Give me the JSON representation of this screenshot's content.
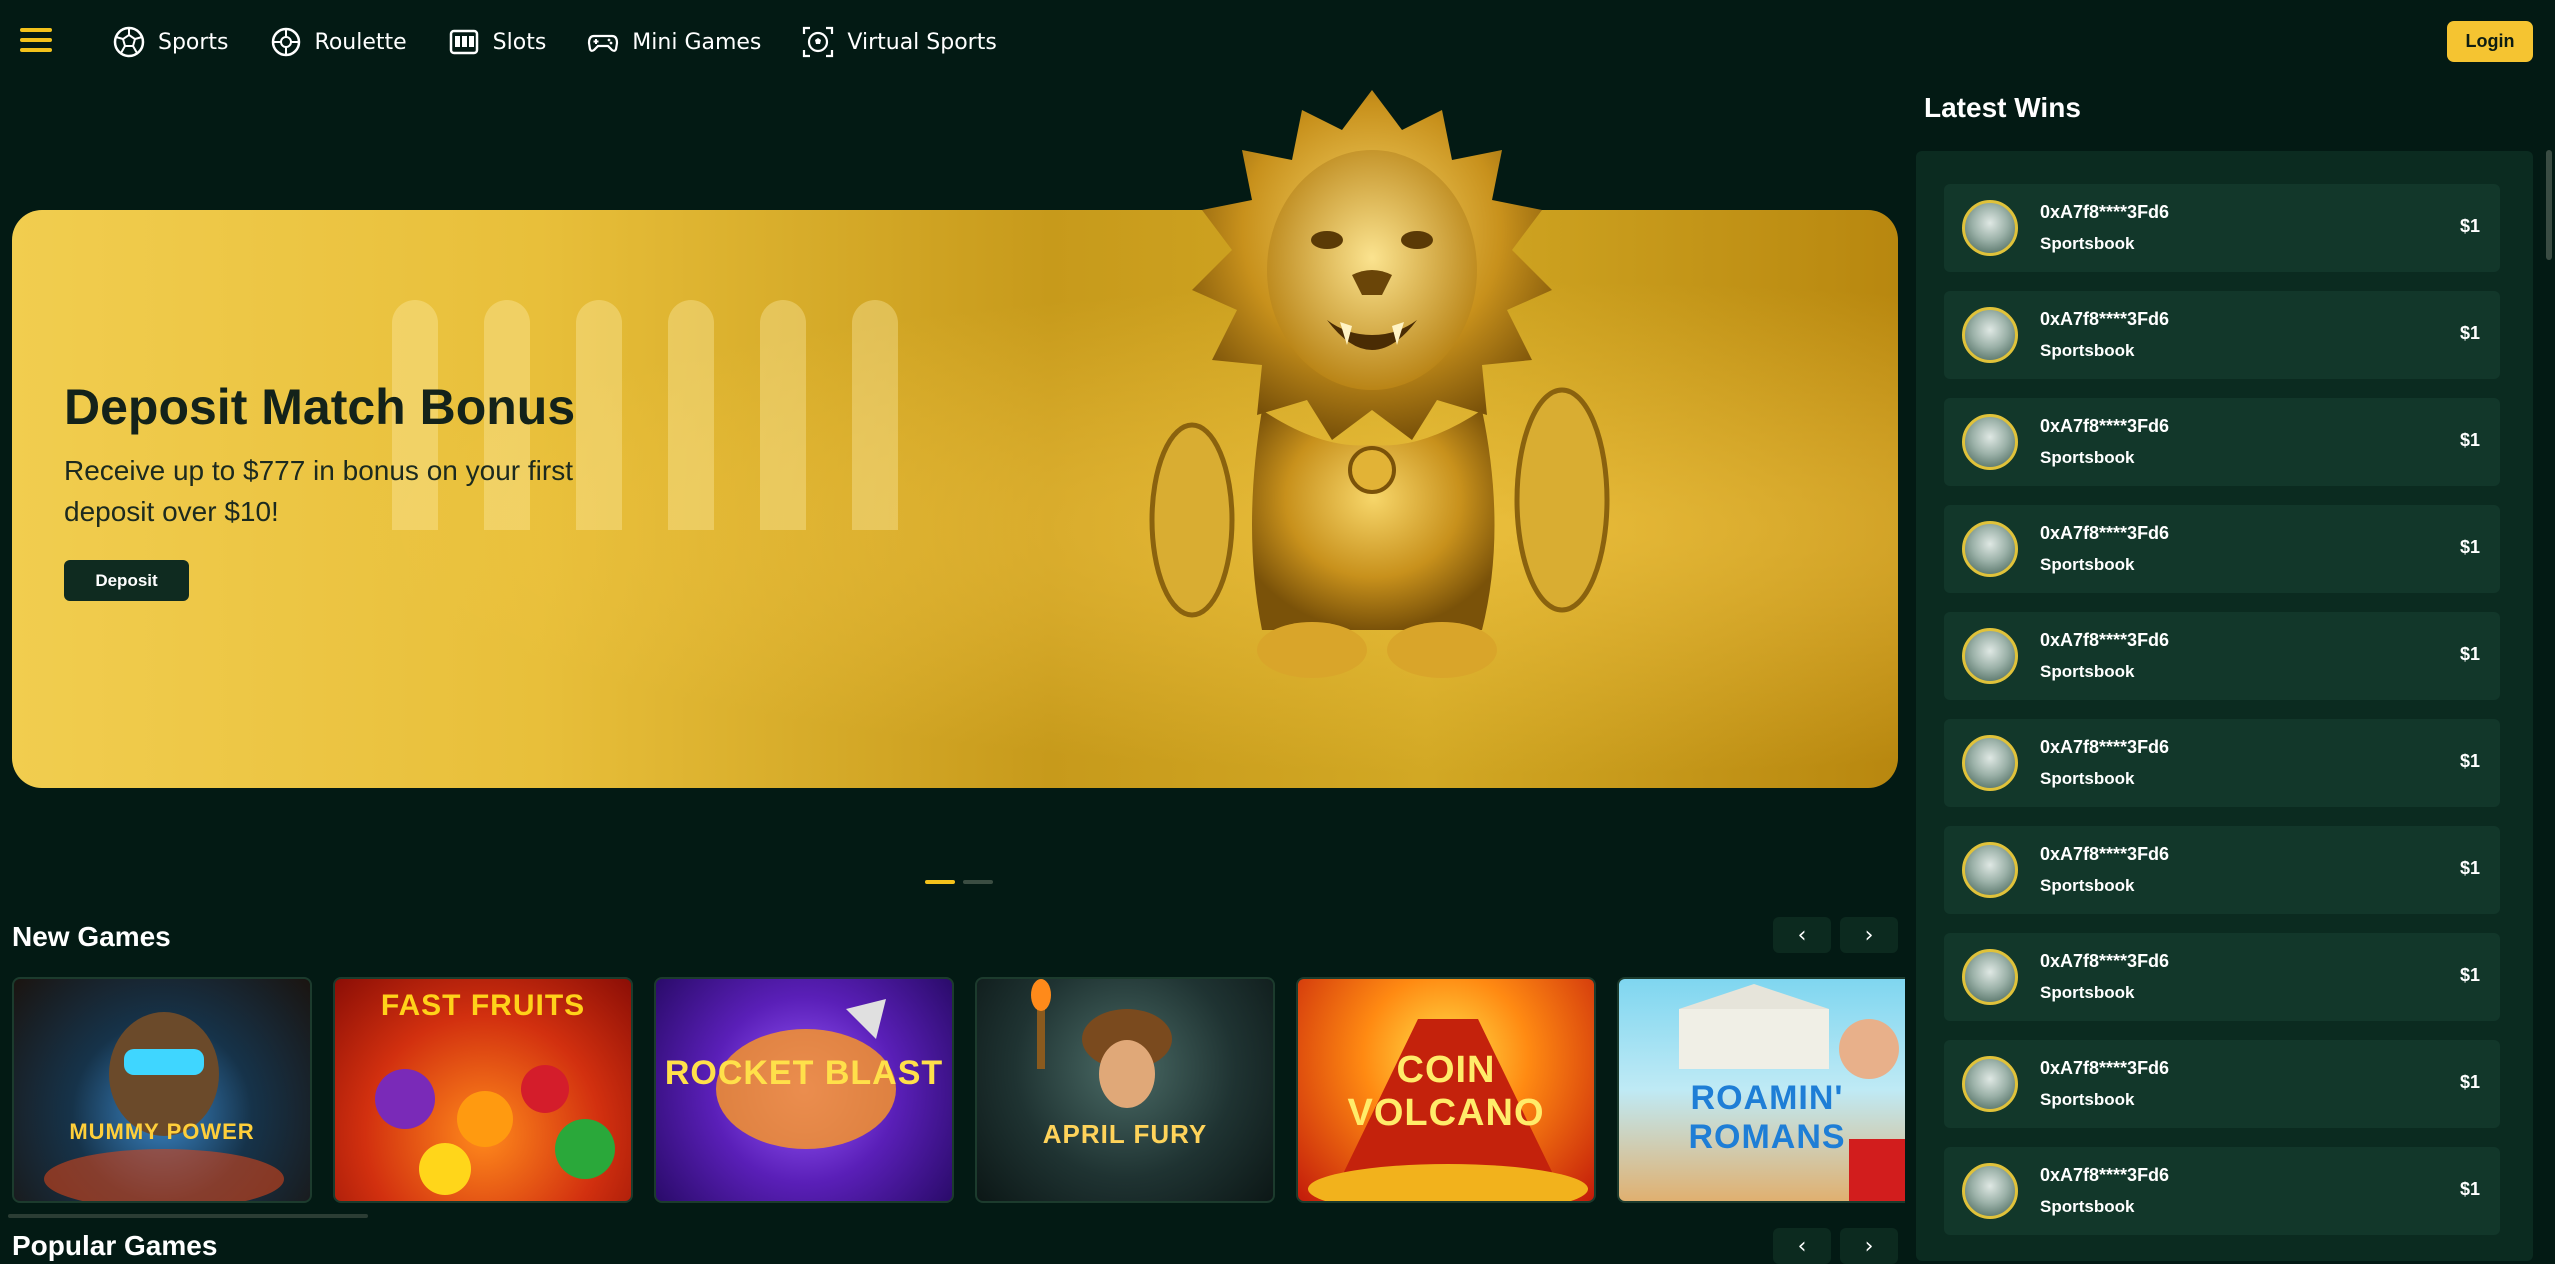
{
  "nav": {
    "items": [
      {
        "label": "Sports",
        "icon": "soccer-ball-icon"
      },
      {
        "label": "Roulette",
        "icon": "roulette-icon"
      },
      {
        "label": "Slots",
        "icon": "slot-machine-icon"
      },
      {
        "label": "Mini Games",
        "icon": "gamepad-icon"
      },
      {
        "label": "Virtual Sports",
        "icon": "virtual-ball-icon"
      }
    ],
    "login_label": "Login"
  },
  "hero": {
    "title": "Deposit Match Bonus",
    "subtitle": "Receive up to $777 in bonus on your first deposit over $10!",
    "button_label": "Deposit",
    "slide_count": 2,
    "active_slide": 1
  },
  "new_games": {
    "title": "New Games",
    "games": [
      {
        "name": "MUMMY POWER"
      },
      {
        "name": "FAST FRUITS"
      },
      {
        "name": "ROCKET BLAST"
      },
      {
        "name": "APRIL FURY"
      },
      {
        "name": "COIN VOLCANO"
      },
      {
        "name": "ROAMIN' ROMANS"
      }
    ]
  },
  "popular_games": {
    "title": "Popular Games"
  },
  "latest_wins": {
    "title": "Latest Wins",
    "rows": [
      {
        "address": "0xA7f8****3Fd6",
        "type": "Sportsbook",
        "amount": "$1"
      },
      {
        "address": "0xA7f8****3Fd6",
        "type": "Sportsbook",
        "amount": "$1"
      },
      {
        "address": "0xA7f8****3Fd6",
        "type": "Sportsbook",
        "amount": "$1"
      },
      {
        "address": "0xA7f8****3Fd6",
        "type": "Sportsbook",
        "amount": "$1"
      },
      {
        "address": "0xA7f8****3Fd6",
        "type": "Sportsbook",
        "amount": "$1"
      },
      {
        "address": "0xA7f8****3Fd6",
        "type": "Sportsbook",
        "amount": "$1"
      },
      {
        "address": "0xA7f8****3Fd6",
        "type": "Sportsbook",
        "amount": "$1"
      },
      {
        "address": "0xA7f8****3Fd6",
        "type": "Sportsbook",
        "amount": "$1"
      },
      {
        "address": "0xA7f8****3Fd6",
        "type": "Sportsbook",
        "amount": "$1"
      },
      {
        "address": "0xA7f8****3Fd6",
        "type": "Sportsbook",
        "amount": "$1"
      }
    ]
  },
  "colors": {
    "background": "#031a14",
    "accent": "#f3c21b",
    "panel": "#0b2b20",
    "row": "#12372a"
  }
}
